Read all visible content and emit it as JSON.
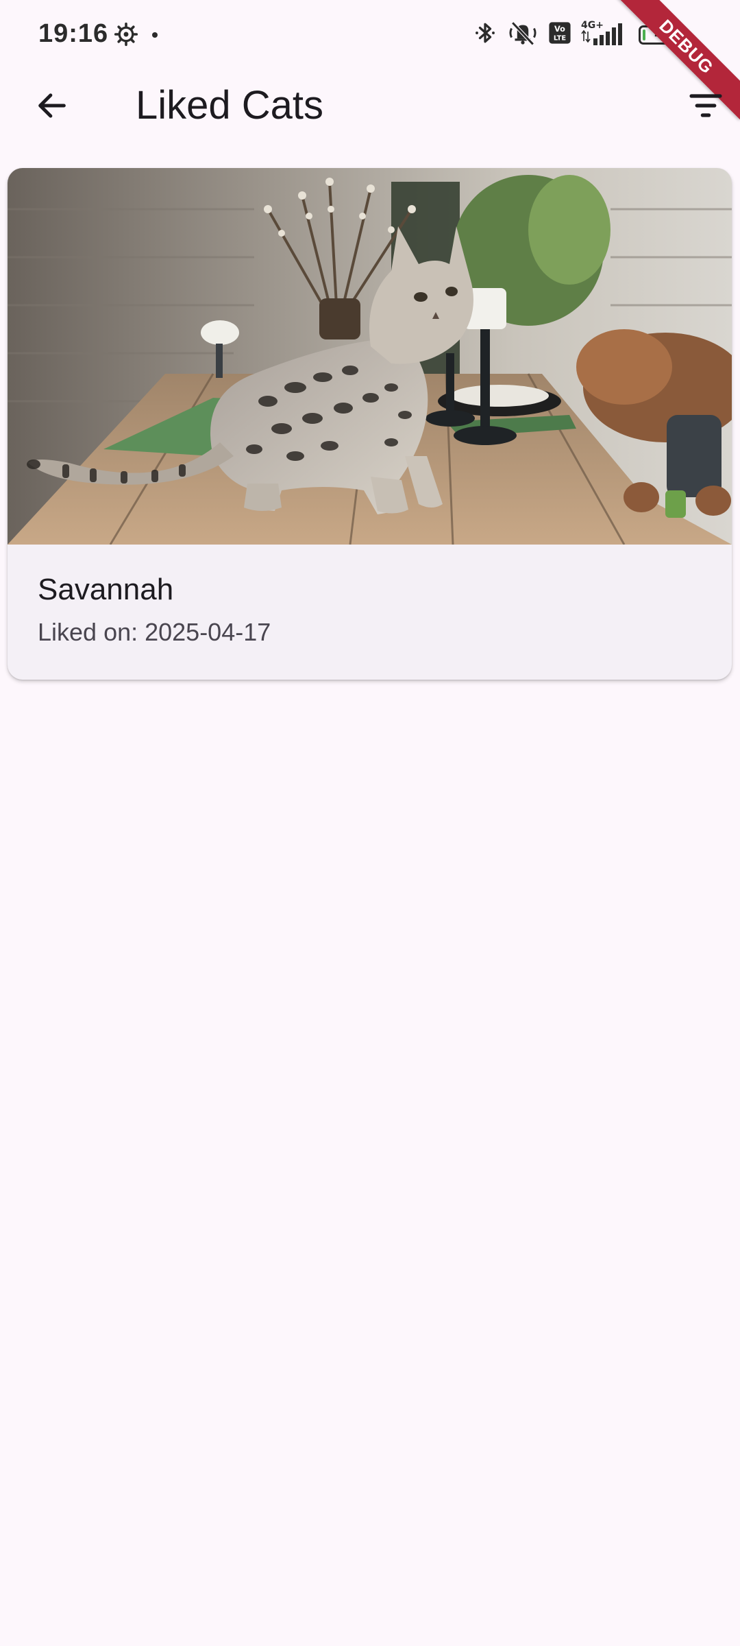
{
  "status_bar": {
    "time": "19:16",
    "network_label": "4G+",
    "volte_label": "Vo LTE",
    "battery_level": "4",
    "icons": [
      "settings-gear-icon",
      "notification-dot-icon",
      "bluetooth-icon",
      "vibrate-off-icon",
      "volte-icon",
      "signal-icon",
      "battery-icon"
    ]
  },
  "debug_banner": "DEBUG",
  "app_bar": {
    "title": "Liked Cats",
    "back_icon": "arrow-back-icon",
    "filter_icon": "filter-list-icon"
  },
  "liked_cats": [
    {
      "breed": "Savannah",
      "liked_label": "Liked on: 2025-04-17",
      "image": "spotted-cat-on-wooden-table-photo"
    }
  ],
  "colors": {
    "background": "#fdf7fc",
    "card": "#f4f0f6",
    "debug_banner": "#b3263a",
    "primary_text": "#1d1b20",
    "secondary_text": "#49454f"
  }
}
